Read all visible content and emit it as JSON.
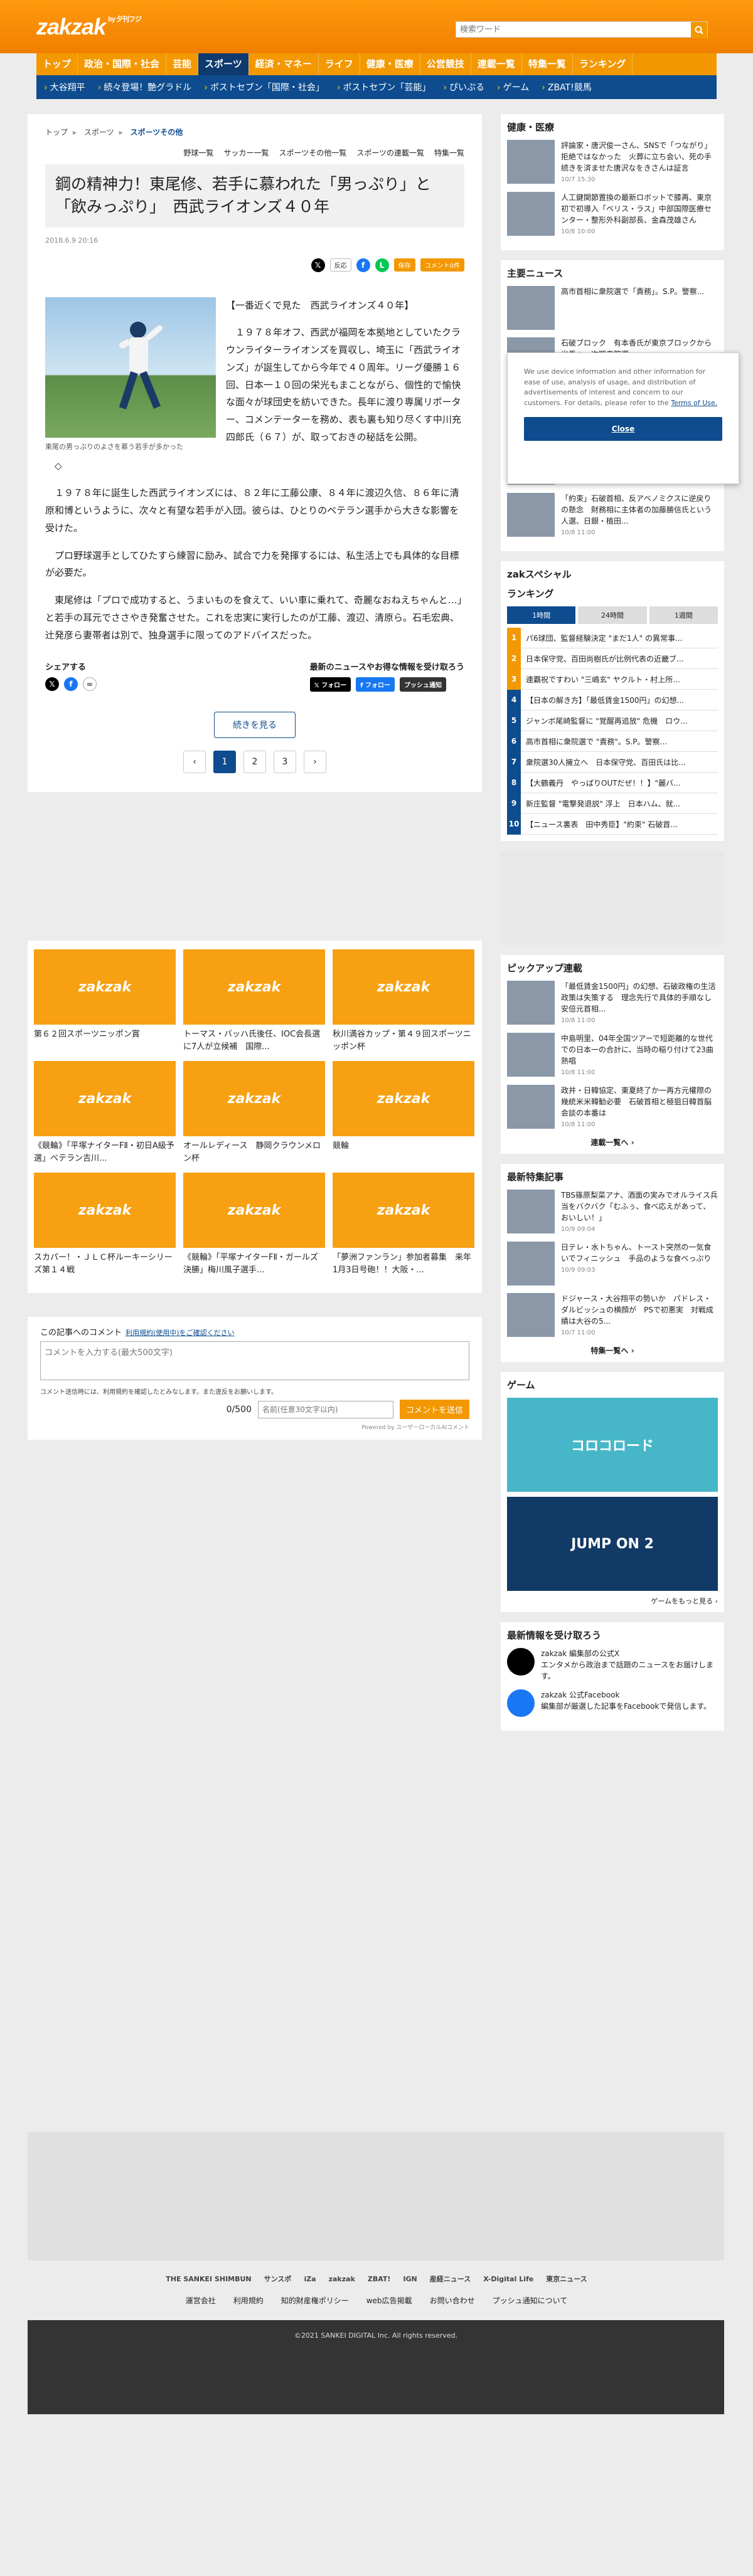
{
  "header": {
    "logo": "zakzak",
    "logo_sub": "by 夕刊フジ",
    "search_placeholder": "検索ワード"
  },
  "gnav": [
    "トップ",
    "政治・国際・社会",
    "芸能",
    "スポーツ",
    "経済・マネー",
    "ライフ",
    "健康・医療",
    "公営競技",
    "連載一覧",
    "特集一覧",
    "ランキング"
  ],
  "subnav": [
    "大谷翔平",
    "続々登場！艶グラドル",
    "ポストセブン「国際・社会」",
    "ポストセブン「芸能」",
    "ぴいぷる",
    "ゲーム",
    "ZBAT!競馬"
  ],
  "breadcrumb": [
    "トップ",
    "スポーツ",
    "スポーツその他"
  ],
  "cattabs": [
    "野球一覧",
    "サッカー一覧",
    "スポーツその他一覧",
    "スポーツの連載一覧",
    "特集一覧"
  ],
  "article": {
    "title": "鋼の精神力！東尾修、若手に慕われた「男っぷり」と「飲みっぷり」　西武ライオンズ４０年",
    "date": "2018.6.9 20:16",
    "share_labels": {
      "react": "反応",
      "bookmark": "保存",
      "comment": "コメント0件"
    },
    "photo_caption": "東尾の男っぷりのよさを慕う若手が多かった",
    "paragraphs": [
      "【一番近くで見た　西武ライオンズ４０年】",
      "１９７８年オフ、西武が福岡を本拠地としていたクラウンライターライオンズを買収し、埼玉に「西武ライオンズ」が誕生してから今年で４０周年。リーグ優勝１６回、日本一１０回の栄光もまことながら、個性的で愉快な面々が球団史を紡いできた。長年に渡り専属リポーター、コメンテーターを務め、表も裏も知り尽くす中川充四郎氏（６７）が、取っておきの秘話を公開。",
      "◇",
      "１９７８年に誕生した西武ライオンズには、８２年に工藤公康、８４年に渡辺久信、８６年に清原和博というように、次々と有望な若手が入団。彼らは、ひとりのベテラン選手から大きな影響を受けた。",
      "プロ野球選手としてひたすら練習に励み、試合で力を発揮するには、私生活上でも具体的な目標が必要だ。",
      "東尾修は「プロで成功すると、うまいものを食えて、いい車に乗れて、奇麗なおねえちゃんと…」と若手の耳元でささやき発奮させた。これを忠実に実行したのが工藤、渡辺、清原ら。石毛宏典、辻発彦ら妻帯者は別で、独身選手に限ってのアドバイスだった。"
    ],
    "share_title": "シェアする",
    "follow_title": "最新のニュースやお得な情報を受け取ろう",
    "follow_buttons": [
      "フォロー",
      "フォロー",
      "プッシュ通知"
    ],
    "more_label": "続きを見る",
    "pages": [
      "‹",
      "1",
      "2",
      "3",
      "›"
    ]
  },
  "grid": [
    {
      "caption": "第６２回スポーツニッポン賞"
    },
    {
      "caption": "トーマス・バッハ氏後任、IOC会長選に7人が立候補　国際..."
    },
    {
      "caption": "秋川満谷カップ・第４９回スポーツニッポン杯"
    },
    {
      "caption": "《競輪》「平塚ナイターFⅡ・初日A級予選」ベテラン吉川..."
    },
    {
      "caption": "オールレディース　静岡クラウンメロン杯"
    },
    {
      "caption": "競輪"
    },
    {
      "caption": "スカパー！・ＪＬＣ杯ルーキーシリーズ第１４戦"
    },
    {
      "caption": "《競輪》「平塚ナイターFⅡ・ガールズ決勝」梅川風子選手..."
    },
    {
      "caption": "「夢洲ファンラン」参加者募集　来年1月3日号砲！！大阪・..."
    }
  ],
  "comment": {
    "title": "この記事へのコメント",
    "terms": "利用規約(使用中)をご確認ください",
    "placeholder": "コメントを入力する(最大500文字)",
    "note": "コメント送信時には、利用規約を確認したとみなします。また違反をお願いします。",
    "count": "0/500",
    "name_placeholder": "名前(任意30文字以内)",
    "send": "コメントを送信",
    "powered": "Powered by ユーザーローカルAIコメント"
  },
  "side": {
    "health_title": "健康・医療",
    "health": [
      {
        "text": "評論家・唐沢俊一さん、SNSで「つながり」拒絶ではなかった　火葬に立ち会い、死の手続きを済ませた唐沢なをきさんは証言",
        "date": "10/7 15:30"
      },
      {
        "text": "人工鍵関節置換の最新ロボットで膝再、東京初で初導入「ベリス・ラス」中部国際医療センター・整形外科副部長、金森茂雄さん",
        "date": "10/8 10:00"
      }
    ],
    "main_news_title": "主要ニュース",
    "main_news": [
      {
        "text": "高市首相に衆院選で「責務」。S.P。警察...",
        "date": ""
      },
      {
        "text": "石破ブロック　有本香氏が東京ブロックから出馬へ　次期衆院選",
        "date": "10/9 13:00"
      },
      {
        "text": "「最低賃金1500円」の幻想、石破政権の生活政策は失策する　理念先行で具体的手順なし　安倍元首相...",
        "date": "10/8 11:00"
      },
      {
        "text": "「最低賃金1500円」の幻想、石破政権の生活政策は失策する　理念先行で具体的手順なし　安倍元首相...",
        "date": "10/8 11:00"
      },
      {
        "text": "「約束」石破首相、反アベノミクスに逆戻りの懸念　財務相に主体者の加藤勝信氏という人選、日銀・植田...",
        "date": "10/8 11:00"
      }
    ],
    "special_title": "zakスペシャル",
    "ranking_title": "ランキング",
    "ranking_tabs": [
      "1時間",
      "24時間",
      "1週間"
    ],
    "ranking": [
      "パ6球団、監督経験決定 \"まだ1人\" の異常事...",
      "日本保守党、百田尚樹氏が比例代表の近畿ブ...",
      "連覇祝ですわい \"三嶋玄\" ヤクルト・村上所...",
      "【日本の解き方】「最低賃金1500円」の幻想...",
      "ジャンボ尾崎監督に \"覚醒再追放\" 危機　ロウ...",
      "高市首相に衆院選で \"責務\"。S.P。警察...",
      "衆院選30人擁立へ　日本保守党、百田氏は比...",
      "【大鶴義丹　やっぱりOUTだぜ！！】\"麗バ...",
      "新庄監督 \"電撃発退説\" 浮上　日本ハム、就...",
      "【ニュース裏表　田中秀臣】\"約束\" 石破首..."
    ],
    "pickup_title": "ピックアップ連載",
    "pickup": [
      {
        "text": "「最低賃金1500円」の幻想、石破政権の生活政策は失策する　理念先行で具体的手順なし　安倍元首相...",
        "date": "10/8 11:00"
      },
      {
        "text": "中島明里、04年全国ツアーで短距離的な世代での日本一の合計に、当時の稲り付けて23曲熱唱",
        "date": "10/8 11:00"
      },
      {
        "text": "政井・日韓協定、東夏終了か一再方元權際の幾統米米韓勧必要　石破首相と極狙日韓首脳会談の本番は",
        "date": "10/8 11:00"
      }
    ],
    "pickup_more": "連載一覧へ",
    "feature_title": "最新特集記事",
    "feature": [
      {
        "text": "TBS篠原梨菜アナ、酒面の実みでオルライス兵当をバクバク「むふぅ、食べ応えがあって、おいしい！」",
        "date": "10/9 09:04"
      },
      {
        "text": "日テレ・水トちゃん、トースト突然の一気食いでフィニッシュ　手品のような食べっぷり",
        "date": "10/9 09:03"
      },
      {
        "text": "ドジャース・大谷翔平の勢いか　パドレス・ダルビッシュの横顔が　PSで初悪実　対戦成績は大谷の5...",
        "date": "10/7 11:00"
      }
    ],
    "feature_more": "特集一覧へ",
    "game_title": "ゲーム",
    "games": [
      "コロコロード",
      "JUMP ON 2"
    ],
    "game_more": "ゲームをもっと見る",
    "follow_title": "最新情報を受け取ろう",
    "follow": [
      {
        "name": "zakzak 編集部の公式X",
        "desc": "エンタメから政治まで話題のニュースをお届けします。"
      },
      {
        "name": "zakzak 公式Facebook",
        "desc": "編集部が厳選した記事をFacebookで発信します。"
      }
    ]
  },
  "footer": {
    "partners": [
      "THE SANKEI SHIMBUN",
      "サンスポ",
      "iZa",
      "zakzak",
      "ZBAT!",
      "IGN",
      "産経ニュース",
      "X-Digital Life",
      "東京ニュース"
    ],
    "links": [
      "運営会社",
      "利用規約",
      "知的財産権ポリシー",
      "web広告掲載",
      "お問い合わせ",
      "プッシュ通知について"
    ],
    "copyright": "©2021 SANKEI DIGITAL Inc. All rights reserved."
  },
  "cookie": {
    "text": "We use device information and other information for ease of use, analysis of usage, and distribution of advertisements of interest and concern to our customers. For details, please refer to the",
    "link": "Terms of Use.",
    "close": "Close"
  },
  "colors": {
    "accent": "#f39800",
    "navy": "#0e4c8f"
  }
}
